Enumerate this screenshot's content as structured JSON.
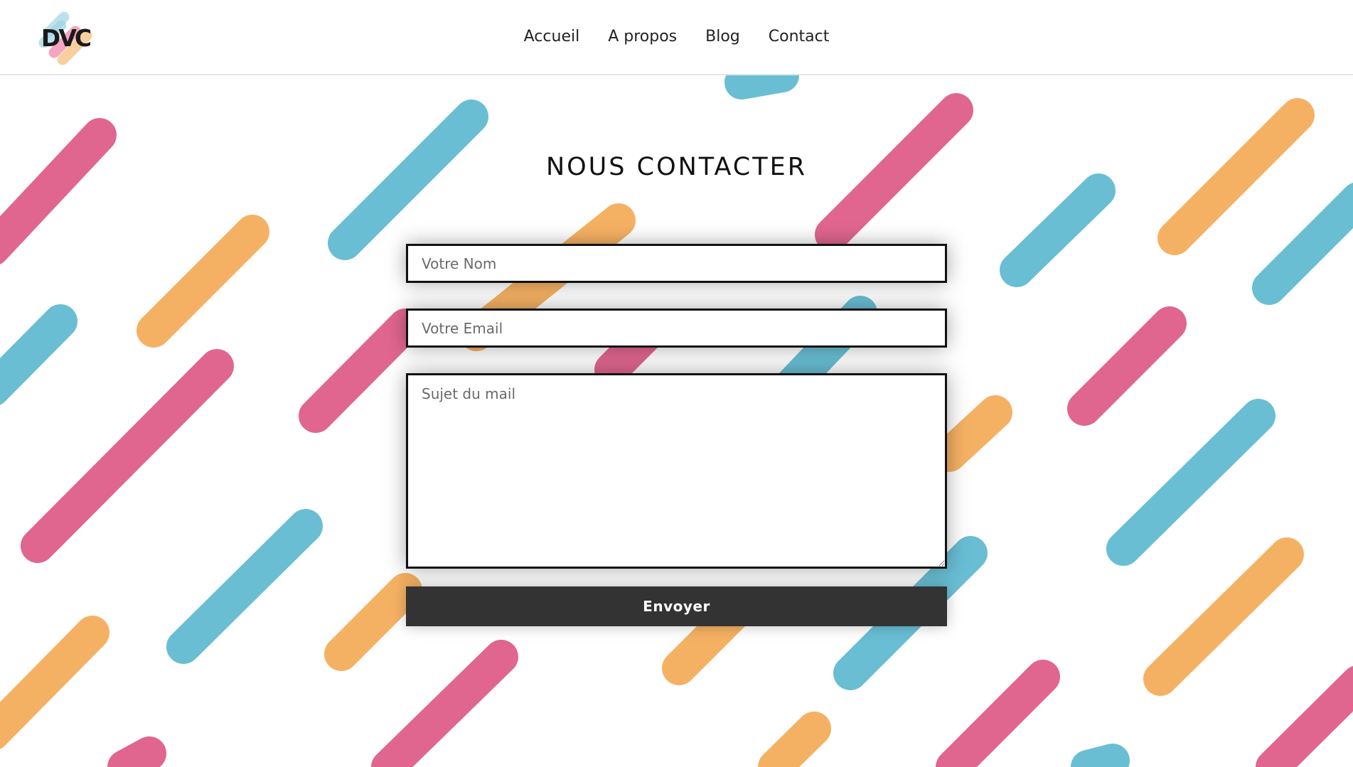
{
  "colors": {
    "pink": "#e0668f",
    "blue": "#69bed4",
    "orange": "#f5b163",
    "button_bg": "#333333",
    "text": "#111111"
  },
  "logo": {
    "icon": "dvc-logo-icon",
    "text": "DVC"
  },
  "nav": {
    "items": [
      {
        "label": "Accueil"
      },
      {
        "label": "A propos"
      },
      {
        "label": "Blog"
      },
      {
        "label": "Contact"
      }
    ]
  },
  "contact": {
    "title": "NOUS CONTACTER",
    "name_placeholder": "Votre Nom",
    "name_value": "",
    "email_placeholder": "Votre Email",
    "email_value": "",
    "subject_placeholder": "Sujet du mail",
    "subject_value": "",
    "submit_label": "Envoyer"
  }
}
